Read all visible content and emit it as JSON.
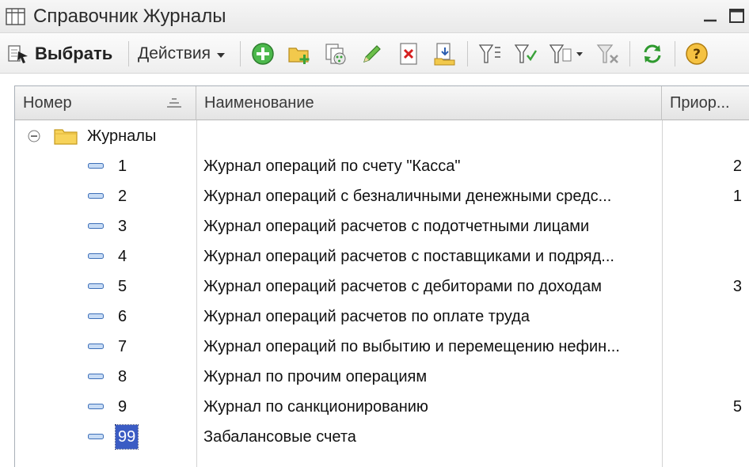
{
  "window": {
    "title": "Справочник Журналы"
  },
  "toolbar": {
    "select_label": "Выбрать",
    "actions_label": "Действия",
    "icons": [
      "select-icon",
      "add-icon",
      "add-group-icon",
      "copy-icon",
      "edit-icon",
      "delete-icon",
      "move-to-group-icon",
      "filter-icon",
      "filter-by-value-icon",
      "filter-history-icon",
      "clear-filter-icon",
      "refresh-icon",
      "help-icon"
    ]
  },
  "grid": {
    "columns": [
      "Номер",
      "Наименование",
      "Приор..."
    ],
    "group": {
      "label": "Журналы"
    },
    "rows": [
      {
        "num": "1",
        "name": "Журнал операций по счету \"Касса\"",
        "priority": "2"
      },
      {
        "num": "2",
        "name": "Журнал операций с безналичными денежными средс...",
        "priority": "1"
      },
      {
        "num": "3",
        "name": "Журнал операций расчетов с подотчетными лицами",
        "priority": ""
      },
      {
        "num": "4",
        "name": "Журнал операций расчетов с поставщиками и подряд...",
        "priority": ""
      },
      {
        "num": "5",
        "name": "Журнал операций расчетов с дебиторами по доходам",
        "priority": "3"
      },
      {
        "num": "6",
        "name": "Журнал операций расчетов по оплате труда",
        "priority": ""
      },
      {
        "num": "7",
        "name": "Журнал операций по выбытию и перемещению нефин...",
        "priority": ""
      },
      {
        "num": "8",
        "name": "Журнал по прочим операциям",
        "priority": ""
      },
      {
        "num": "9",
        "name": "Журнал по санкционированию",
        "priority": "5"
      },
      {
        "num": "99",
        "name": "Забалансовые счета",
        "priority": ""
      }
    ]
  },
  "colors": {
    "selection": "#3b5cc4",
    "add_green": "#3aa23a",
    "folder_yellow": "#f2c94c"
  }
}
